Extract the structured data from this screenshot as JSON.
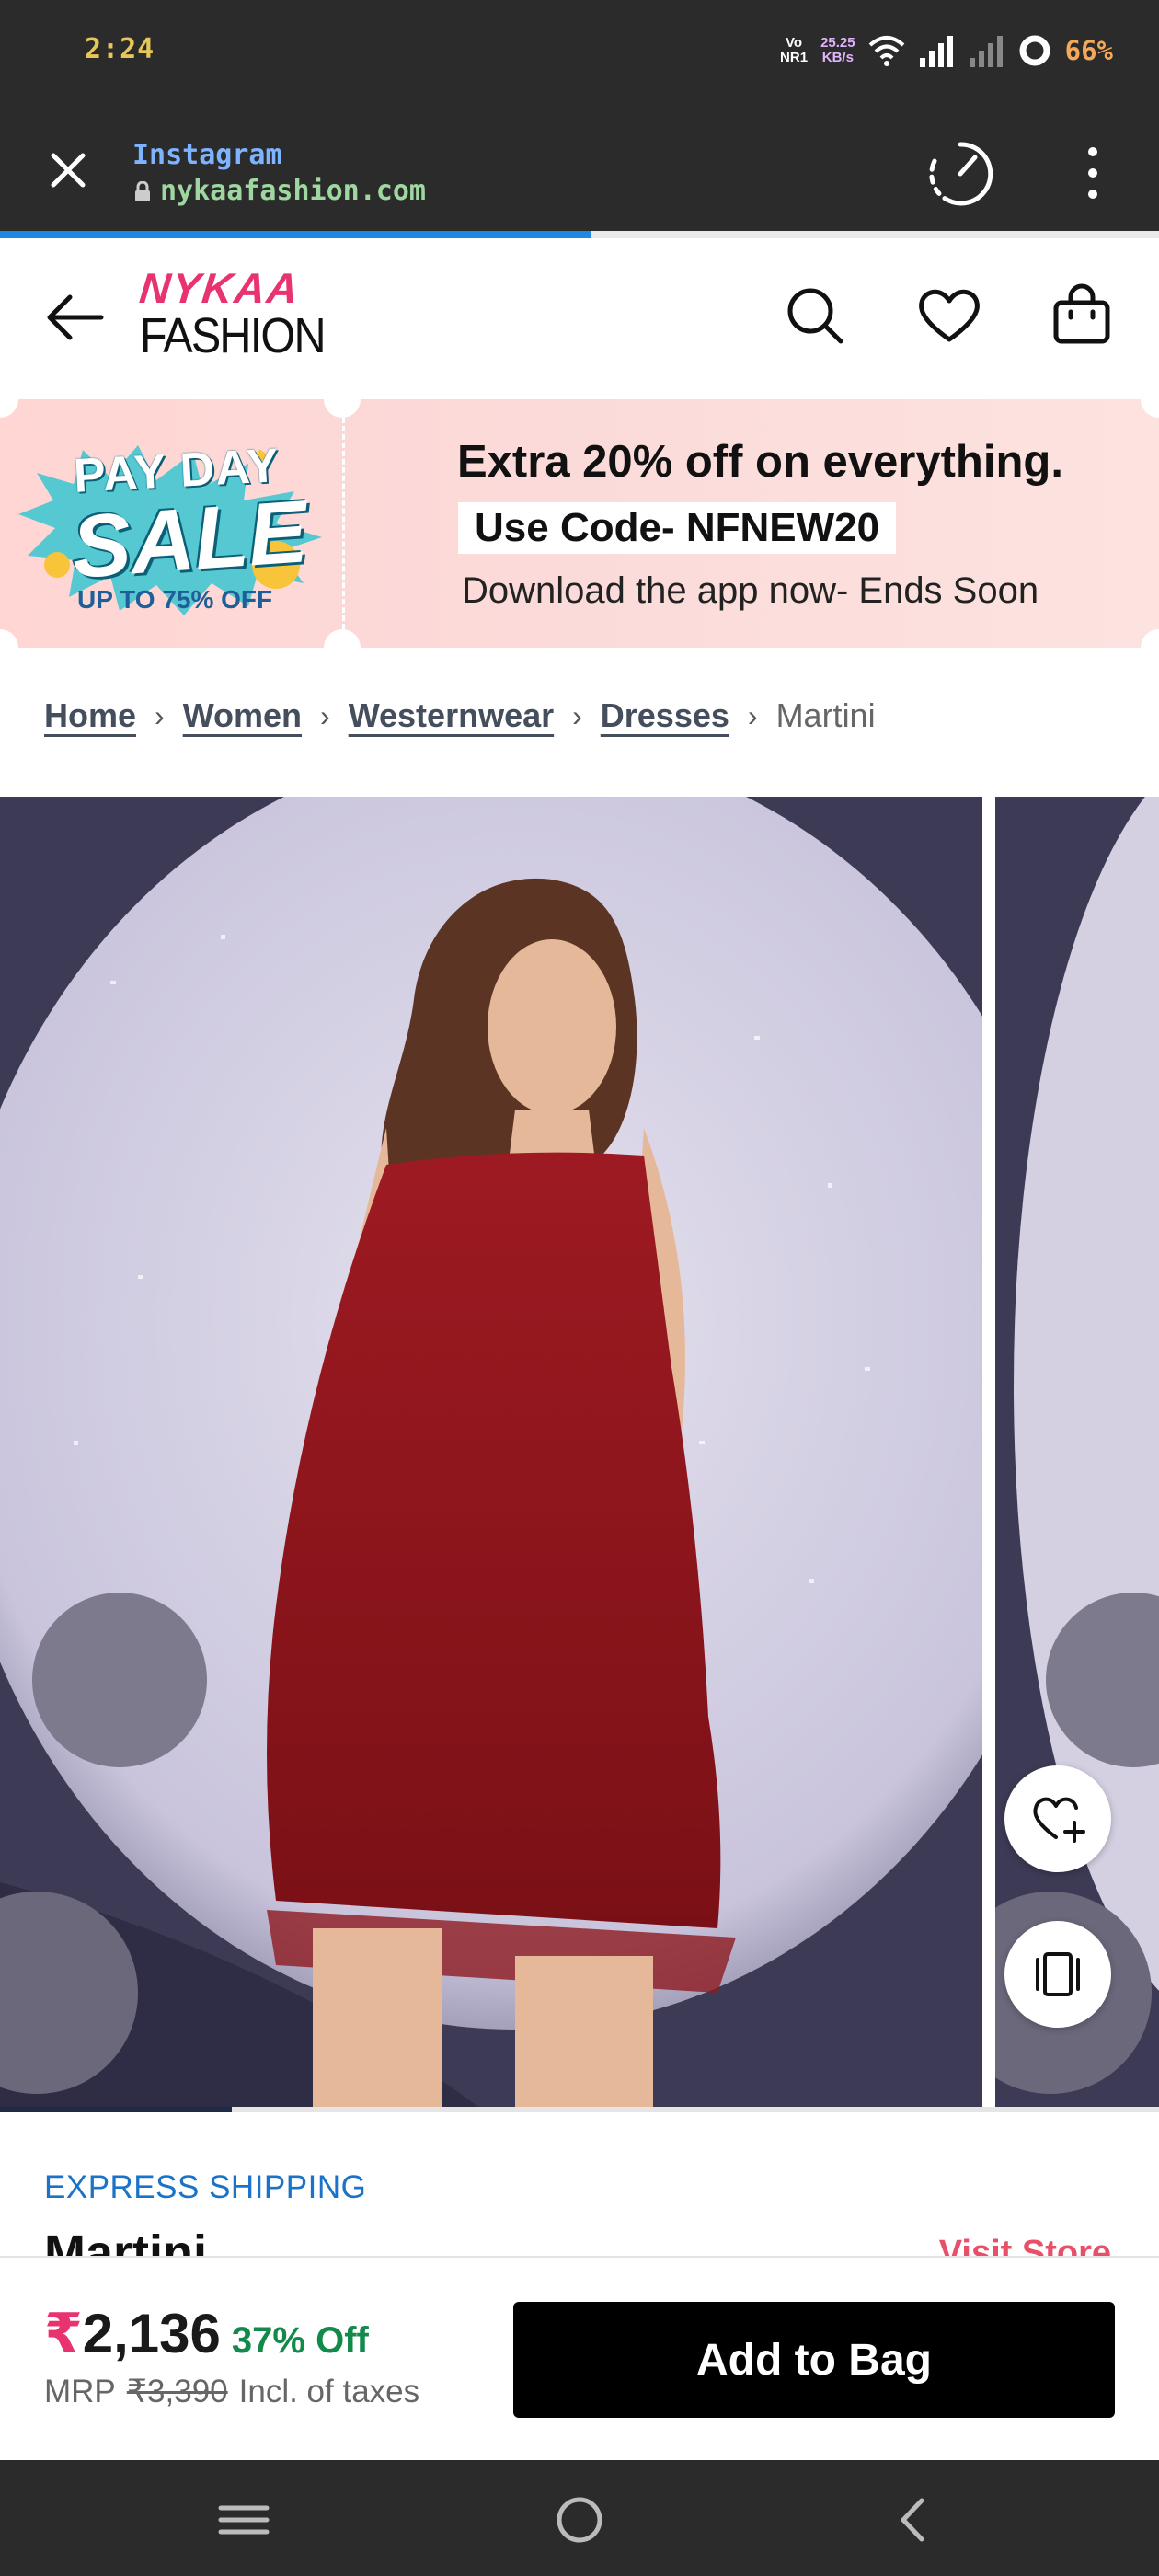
{
  "status_bar": {
    "time": "2:24",
    "volte_top": "Vo",
    "volte_bottom": "NR1",
    "speed_top": "25.25",
    "speed_bottom": "KB/s",
    "battery": "66%"
  },
  "browser": {
    "app_name": "Instagram",
    "url": "nykaafashion.com",
    "load_progress": 0.51
  },
  "header": {
    "logo_top": "NYKAA",
    "logo_bottom": "FASHION"
  },
  "promo": {
    "badge_top": "PAY DAY",
    "badge_main": "SALE",
    "badge_bottom": "UP TO 75% OFF",
    "line1": "Extra 20% off on everything.",
    "code": "Use Code- NFNEW20",
    "line3": "Download the app now- Ends Soon"
  },
  "breadcrumb": {
    "items": [
      "Home",
      "Women",
      "Westernwear",
      "Dresses"
    ],
    "current": "Martini",
    "separator": "›"
  },
  "gallery": {
    "image_progress": 0.2
  },
  "product": {
    "shipping_label": "EXPRESS SHIPPING",
    "title": "Martini",
    "visit_store": "Visit Store"
  },
  "buy_bar": {
    "rupee": "₹",
    "price": "2,136",
    "discount": "37% Off",
    "mrp_label": "MRP",
    "mrp_value": "₹3,390",
    "tax_note": "Incl. of taxes",
    "add_to_bag": "Add to Bag"
  },
  "colors": {
    "brand_pink": "#e8336f",
    "express_blue": "#1a73c9",
    "discount_green": "#128a4a",
    "progress_blue": "#1e88e5"
  }
}
